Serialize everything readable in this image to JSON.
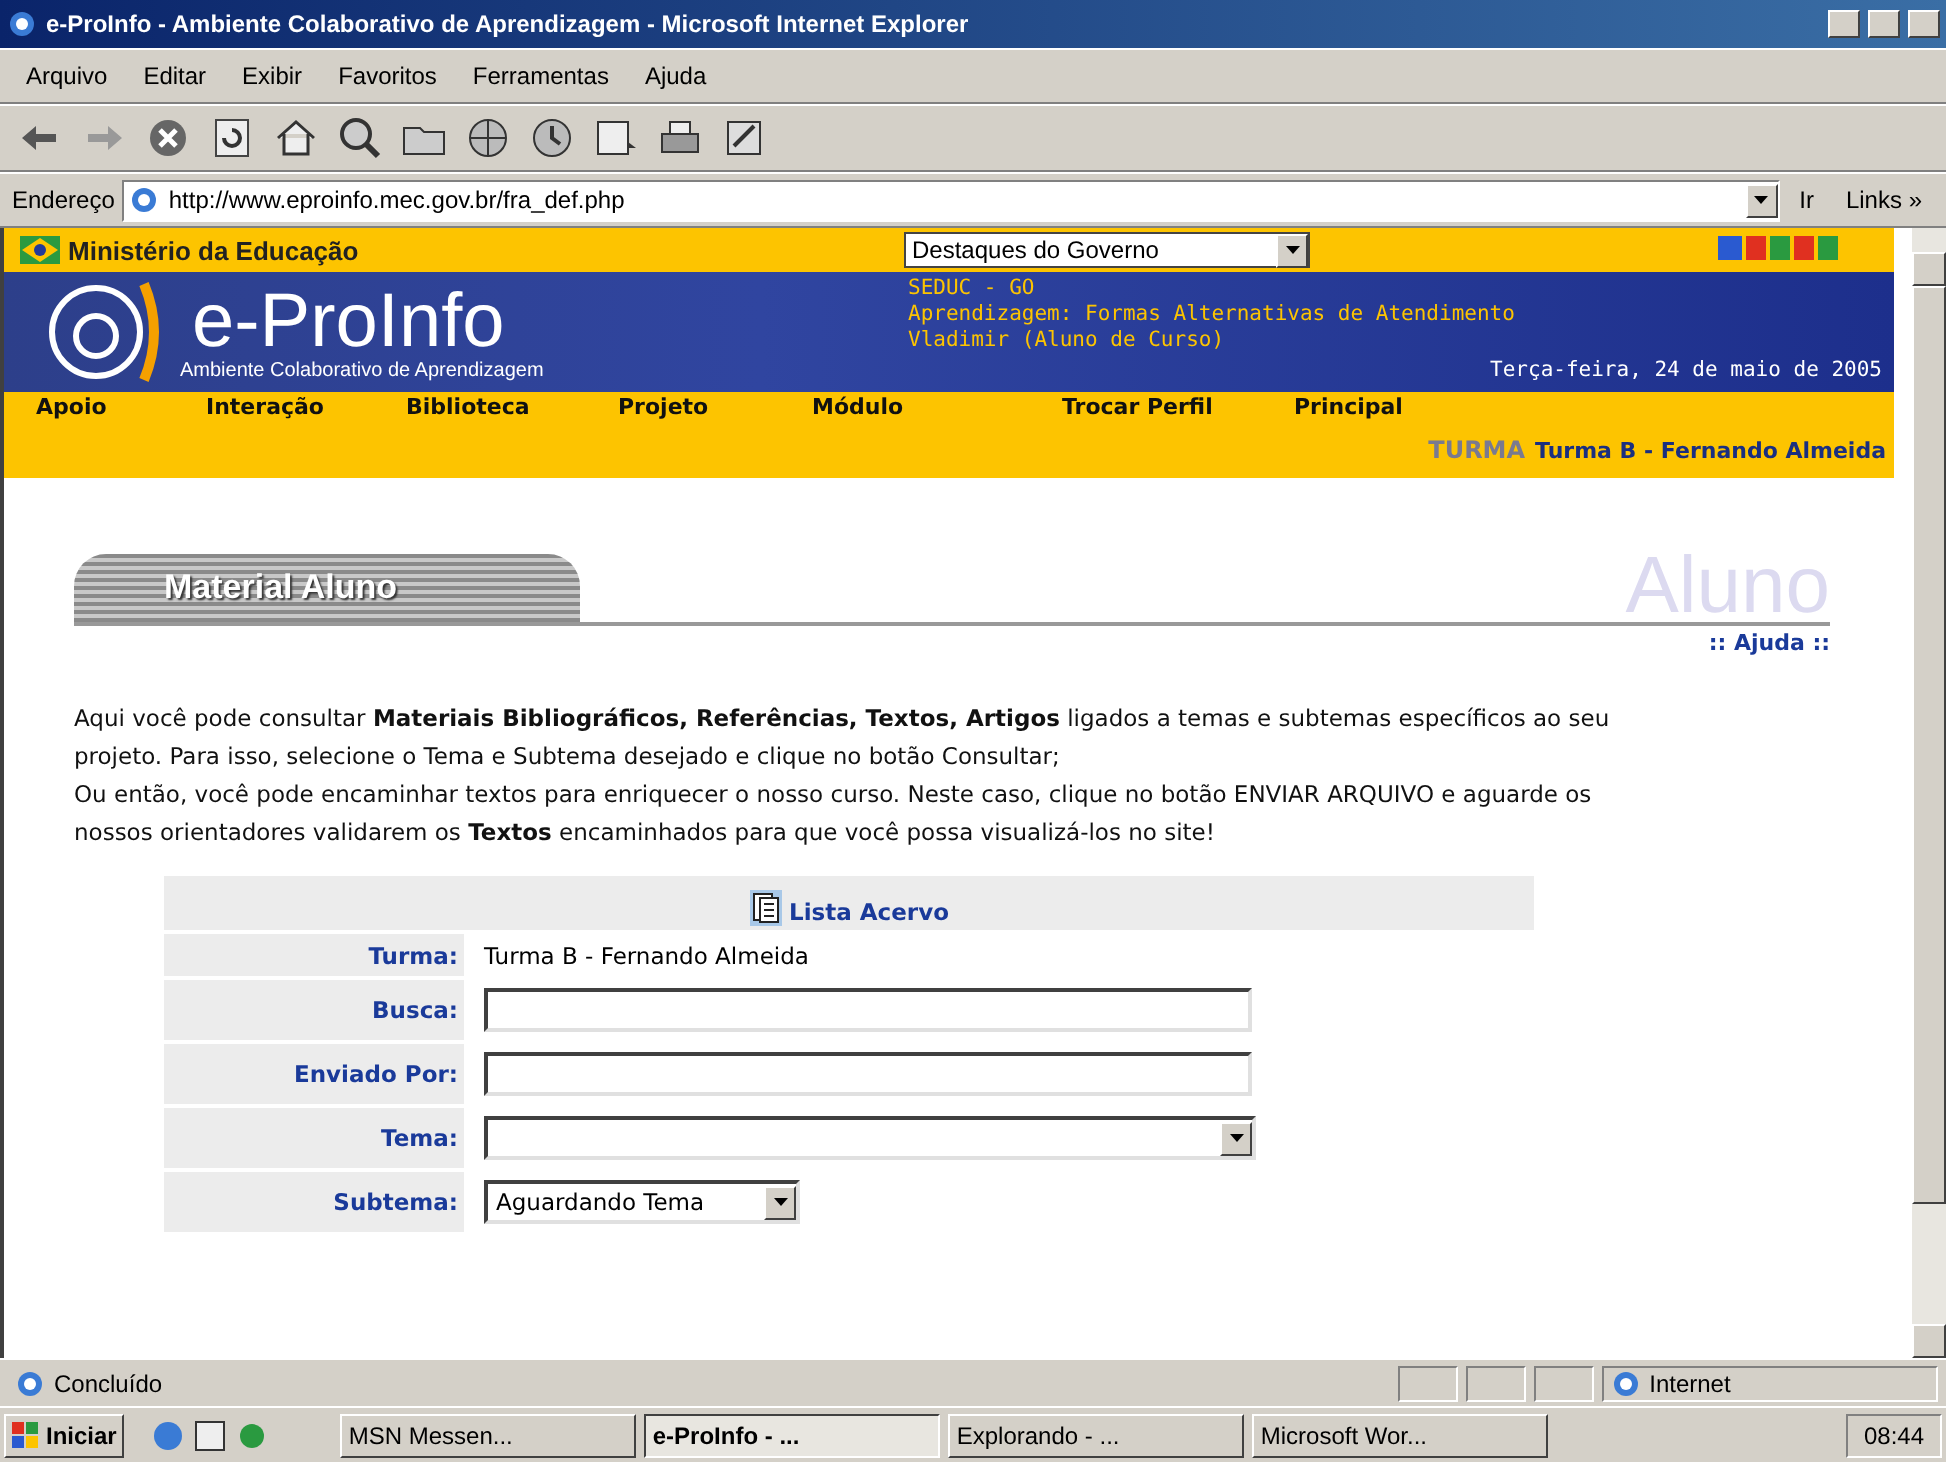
{
  "window": {
    "title": "e-ProInfo - Ambiente Colaborativo de Aprendizagem - Microsoft Internet Explorer"
  },
  "menu": [
    "Arquivo",
    "Editar",
    "Exibir",
    "Favoritos",
    "Ferramentas",
    "Ajuda"
  ],
  "address": {
    "label": "Endereço",
    "url": "http://www.eproinfo.mec.gov.br/fra_def.php",
    "go": "Ir",
    "links": "Links »"
  },
  "header": {
    "ministry": "Ministério da Educação",
    "dropdown": "Destaques do Governo",
    "logo": "e-ProInfo",
    "subtitle": "Ambiente Colaborativo de Aprendizagem",
    "info": [
      "SEDUC - GO",
      "Aprendizagem: Formas Alternativas de Atendimento",
      "Vladimir (Aluno de Curso)"
    ],
    "date": "Terça-feira, 24 de maio de 2005",
    "nav": [
      "Apoio",
      "Interação",
      "Biblioteca",
      "Projeto",
      "Módulo",
      "Trocar Perfil",
      "Principal"
    ],
    "turma_label": "TURMA",
    "turma_value": "Turma B - Fernando Almeida"
  },
  "section": {
    "title": "Material Aluno",
    "role": "Aluno",
    "help": ":: Ajuda ::"
  },
  "paragraphs": [
    "Aqui você pode consultar **Materiais Bibliográficos, Referências, Textos, Artigos** ligados a temas e subtemas específicos ao seu projeto. Para isso, selecione o Tema e Subtema desejado e clique no botão Consultar;",
    "Ou então, você pode encaminhar textos para enriquecer o nosso curso. Neste caso, clique no botão ENVIAR ARQUIVO e aguarde os nossos orientadores validarem os **Textos** encaminhados para que você possa visualizá-los no site!"
  ],
  "form": {
    "title": "Lista Acervo",
    "rows": [
      {
        "label": "Turma:",
        "kind": "text",
        "value": "Turma B - Fernando Almeida"
      },
      {
        "label": "Busca:",
        "kind": "input"
      },
      {
        "label": "Enviado Por:",
        "kind": "input"
      },
      {
        "label": "Tema:",
        "kind": "select"
      },
      {
        "label": "Subtema:",
        "kind": "small-select",
        "value": "Aguardando Tema"
      }
    ]
  },
  "status_bar": {
    "text": "Concluído",
    "zone": "Internet"
  },
  "taskbar": {
    "start": "Iniciar",
    "tasks": [
      {
        "label": "MSN Messen...",
        "selected": false
      },
      {
        "label": "e-ProInfo - ...",
        "selected": true
      },
      {
        "label": "Explorando - ...",
        "selected": false
      },
      {
        "label": "Microsoft Wor...",
        "selected": false
      }
    ],
    "clock": "08:44"
  }
}
